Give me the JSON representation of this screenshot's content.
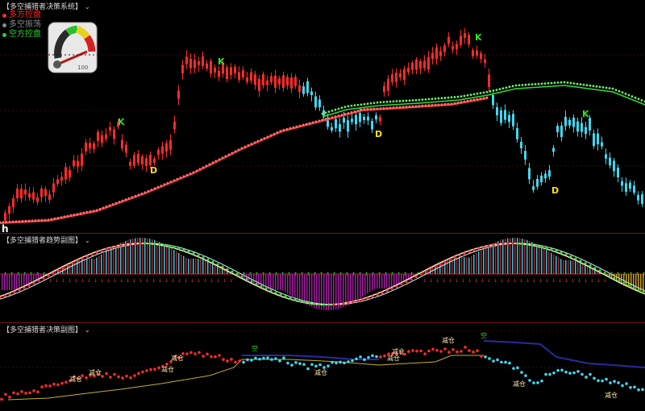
{
  "panels": {
    "main": {
      "title": "【多空捕猎者决策系统】",
      "legend": [
        {
          "label": "多方控盘",
          "color": "#ff2a2a"
        },
        {
          "label": "多空振荡",
          "color": "#8a8a8a"
        },
        {
          "label": "空方控盘",
          "color": "#30d030"
        }
      ],
      "gauge_value": "100",
      "marks": [
        {
          "text": "K",
          "color": "#2fe02f"
        },
        {
          "text": "D",
          "color": "#ffe020"
        },
        {
          "text": "K",
          "color": "#2fe02f"
        },
        {
          "text": "D",
          "color": "#ffe020"
        },
        {
          "text": "K",
          "color": "#2fe02f"
        },
        {
          "text": "D",
          "color": "#ffe020"
        },
        {
          "text": "K",
          "color": "#2fe02f"
        }
      ],
      "corner_glyph": "h"
    },
    "trend": {
      "title": "【多空捕猎者趋势副图】"
    },
    "decision": {
      "title": "【多空捕猎者决策副图】",
      "labels": [
        "减仓",
        "减仓",
        "减仓",
        "空",
        "减仓",
        "减仓",
        "减仓",
        "减仓",
        "减仓",
        "空",
        "减仓",
        "减仓"
      ]
    }
  },
  "colors": {
    "bull": "#ff2a2a",
    "bear": "#40d8f0",
    "fast_line": "#30e030",
    "slow_line": "#ff3030",
    "separator": "#7a1414"
  }
}
